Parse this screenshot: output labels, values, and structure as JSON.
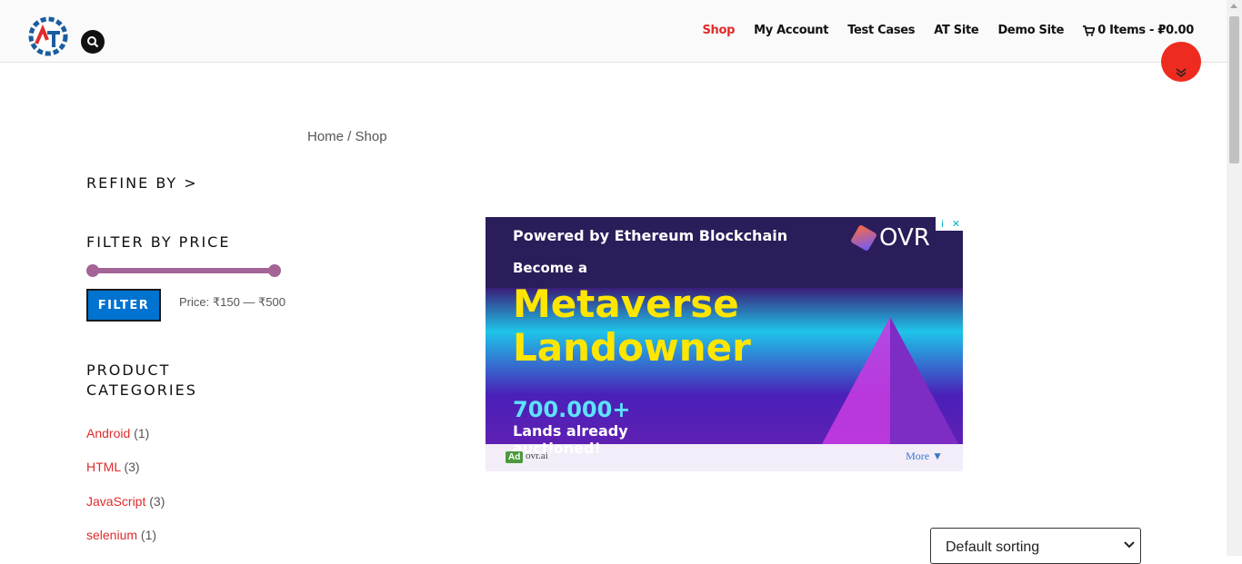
{
  "header": {
    "nav": [
      {
        "label": "Shop",
        "active": true
      },
      {
        "label": "My Account",
        "active": false
      },
      {
        "label": "Test Cases",
        "active": false
      },
      {
        "label": "AT Site",
        "active": false
      },
      {
        "label": "Demo Site",
        "active": false
      }
    ],
    "cart_label": "0 Items - ₽0.00",
    "accent_color": "#e02b2b"
  },
  "breadcrumb": {
    "home": "Home",
    "separator": " / ",
    "current": "Shop"
  },
  "sidebar": {
    "refine_title": "REFINE BY >",
    "filter_title": "FILTER BY PRICE",
    "filter_button": "FILTER",
    "price_label": "Price: ₹150 — ₹500",
    "categories_title_line1": "PRODUCT",
    "categories_title_line2": "CATEGORIES",
    "categories": [
      {
        "name": "Android",
        "count": "(1)"
      },
      {
        "name": "HTML",
        "count": "(3)"
      },
      {
        "name": "JavaScript",
        "count": "(3)"
      },
      {
        "name": "selenium",
        "count": "(1)"
      }
    ]
  },
  "ad": {
    "line1": "Powered by Ethereum Blockchain",
    "brand": "OVR",
    "line2": "Become a",
    "headline1": "Metaverse",
    "headline2": "Landowner",
    "number": "700.000+",
    "sub1": "Lands already",
    "sub2": "auctioned!",
    "badge": "Ad",
    "domain": "ovr.ai",
    "more": "More ▼"
  },
  "sorting": {
    "selected": "Default sorting"
  }
}
